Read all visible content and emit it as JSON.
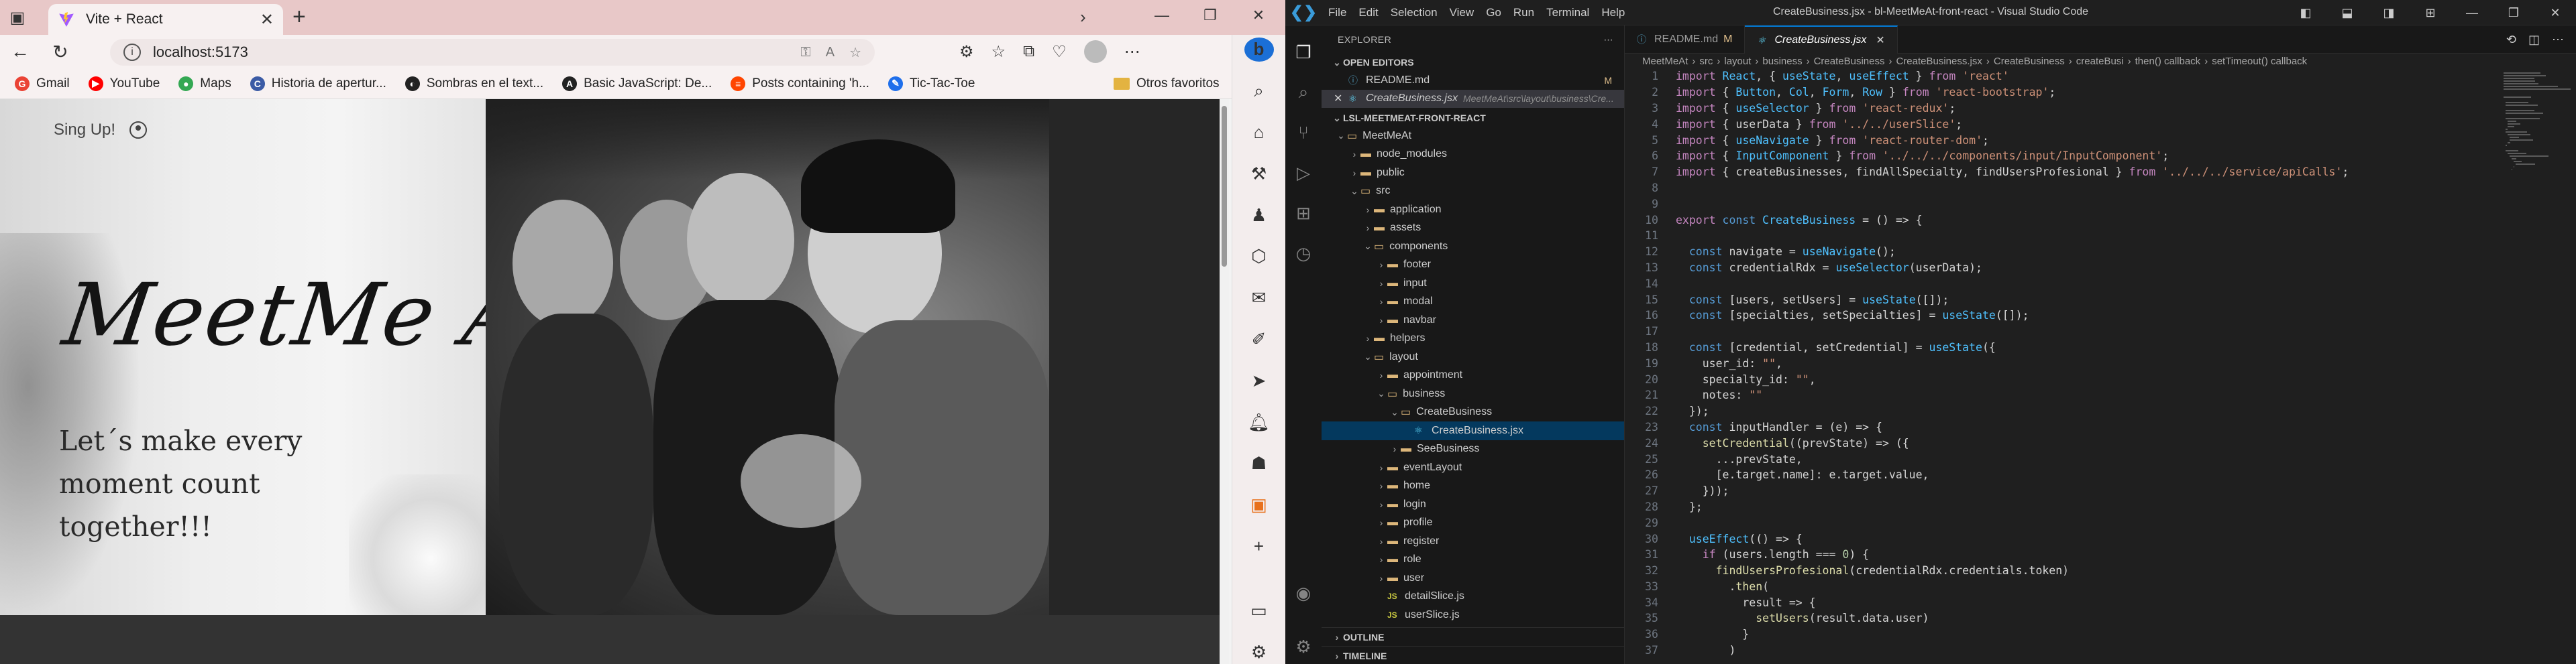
{
  "browser": {
    "tab_title": "Vite + React",
    "address": "localhost:5173",
    "bookmarks": [
      {
        "label": "Gmail",
        "color": "#ea4335",
        "glyph": "G"
      },
      {
        "label": "YouTube",
        "color": "#ff0000",
        "glyph": "▶"
      },
      {
        "label": "Maps",
        "color": "#34a853",
        "glyph": "●"
      },
      {
        "label": "Historia de apertur...",
        "color": "#3b5ba5",
        "glyph": "C"
      },
      {
        "label": "Sombras en el text...",
        "color": "#222222",
        "glyph": "◐"
      },
      {
        "label": "Basic JavaScript: De...",
        "color": "#222222",
        "glyph": "A"
      },
      {
        "label": "Posts containing 'h...",
        "color": "#ff4500",
        "glyph": "≡"
      },
      {
        "label": "Tic-Tac-Toe",
        "color": "#1f6feb",
        "glyph": "✎"
      }
    ],
    "other_bookmarks": "Otros favoritos",
    "page": {
      "signup": "Sing Up!",
      "brand": "MeetMe At",
      "tagline": "Let´s make every moment count together!!!"
    }
  },
  "vscode": {
    "title": "CreateBusiness.jsx - bl-MeetMeAt-front-react - Visual Studio Code",
    "menu": [
      "File",
      "Edit",
      "Selection",
      "View",
      "Go",
      "Run",
      "Terminal",
      "Help"
    ],
    "explorer_label": "EXPLORER",
    "open_editors_label": "OPEN EDITORS",
    "open_editors": [
      {
        "name": "README.md",
        "badge": "M"
      },
      {
        "name": "CreateBusiness.jsx",
        "path": "MeetMeAt\\src\\layout\\business\\Cre..."
      }
    ],
    "project_label": "LSL-MEETMEAT-FRONT-REACT",
    "tree": [
      {
        "name": "MeetMeAt",
        "depth": 0,
        "type": "folder",
        "open": true
      },
      {
        "name": "node_modules",
        "depth": 1,
        "type": "folder",
        "open": false
      },
      {
        "name": "public",
        "depth": 1,
        "type": "folder",
        "open": false
      },
      {
        "name": "src",
        "depth": 1,
        "type": "folder",
        "open": true
      },
      {
        "name": "application",
        "depth": 2,
        "type": "folder",
        "open": false
      },
      {
        "name": "assets",
        "depth": 2,
        "type": "folder",
        "open": false
      },
      {
        "name": "components",
        "depth": 2,
        "type": "folder",
        "open": true
      },
      {
        "name": "footer",
        "depth": 3,
        "type": "folder",
        "open": false
      },
      {
        "name": "input",
        "depth": 3,
        "type": "folder",
        "open": false
      },
      {
        "name": "modal",
        "depth": 3,
        "type": "folder",
        "open": false
      },
      {
        "name": "navbar",
        "depth": 3,
        "type": "folder",
        "open": false
      },
      {
        "name": "helpers",
        "depth": 2,
        "type": "folder",
        "open": false
      },
      {
        "name": "layout",
        "depth": 2,
        "type": "folder",
        "open": true
      },
      {
        "name": "appointment",
        "depth": 3,
        "type": "folder",
        "open": false
      },
      {
        "name": "business",
        "depth": 3,
        "type": "folder",
        "open": true
      },
      {
        "name": "CreateBusiness",
        "depth": 4,
        "type": "folder",
        "open": true
      },
      {
        "name": "CreateBusiness.jsx",
        "depth": 5,
        "type": "react",
        "selected": true
      },
      {
        "name": "SeeBusiness",
        "depth": 4,
        "type": "folder",
        "open": false
      },
      {
        "name": "eventLayout",
        "depth": 3,
        "type": "folder",
        "open": false
      },
      {
        "name": "home",
        "depth": 3,
        "type": "folder",
        "open": false
      },
      {
        "name": "login",
        "depth": 3,
        "type": "folder",
        "open": false
      },
      {
        "name": "profile",
        "depth": 3,
        "type": "folder",
        "open": false
      },
      {
        "name": "register",
        "depth": 3,
        "type": "folder",
        "open": false
      },
      {
        "name": "role",
        "depth": 3,
        "type": "folder",
        "open": false
      },
      {
        "name": "user",
        "depth": 3,
        "type": "folder",
        "open": false
      },
      {
        "name": "detailSlice.js",
        "depth": 3,
        "type": "js"
      },
      {
        "name": "userSlice.js",
        "depth": 3,
        "type": "js"
      }
    ],
    "outline_label": "OUTLINE",
    "timeline_label": "TIMELINE",
    "tabs": [
      {
        "name": "README.md",
        "badge": "M",
        "active": false
      },
      {
        "name": "CreateBusiness.jsx",
        "active": true
      }
    ],
    "breadcrumbs": [
      "MeetMeAt",
      "src",
      "layout",
      "business",
      "CreateBusiness",
      "CreateBusiness.jsx",
      "CreateBusiness",
      "createBusi",
      "then() callback",
      "setTimeout() callback"
    ],
    "code_lines": [
      "import React, { useState, useEffect } from 'react'",
      "import { Button, Col, Form, Row } from 'react-bootstrap';",
      "import { useSelector } from 'react-redux';",
      "import { userData } from '../../userSlice';",
      "import { useNavigate } from 'react-router-dom';",
      "import { InputComponent } from '../../../components/input/InputComponent';",
      "import { createBusinesses, findAllSpecialty, findUsersProfesional } from '../../../service/apiCalls';",
      "",
      "",
      "export const CreateBusiness = () => {",
      "",
      "  const navigate = useNavigate();",
      "  const credentialRdx = useSelector(userData);",
      "",
      "  const [users, setUsers] = useState([]);",
      "  const [specialties, setSpecialties] = useState([]);",
      "",
      "  const [credential, setCredential] = useState({",
      "    user_id: \"\",",
      "    specialty_id: \"\",",
      "    notes: \"\"",
      "  });",
      "  const inputHandler = (e) => {",
      "    setCredential((prevState) => ({",
      "      ...prevState,",
      "      [e.target.name]: e.target.value,",
      "    }));",
      "  };",
      "",
      "  useEffect(() => {",
      "    if (users.length === 0) {",
      "      findUsersProfesional(credentialRdx.credentials.token)",
      "        .then(",
      "          result => {",
      "            setUsers(result.data.user)",
      "          }",
      "        )"
    ]
  }
}
